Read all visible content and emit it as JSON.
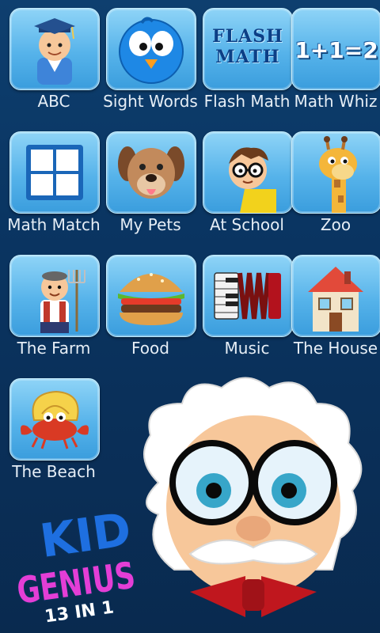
{
  "apps": [
    {
      "label": "ABC",
      "icon": "graduate-boy-icon"
    },
    {
      "label": "Sight Words",
      "icon": "blue-bird-icon"
    },
    {
      "label": "Flash Math",
      "icon": "flash-math-text-icon",
      "icon_text": "FLASH MATH"
    },
    {
      "label": "Math Whiz",
      "icon": "equation-icon",
      "icon_text": "1+1=2"
    },
    {
      "label": "Math Match",
      "icon": "grid-icon"
    },
    {
      "label": "My Pets",
      "icon": "puppy-icon"
    },
    {
      "label": "At School",
      "icon": "school-kid-icon"
    },
    {
      "label": "Zoo",
      "icon": "giraffe-icon"
    },
    {
      "label": "The Farm",
      "icon": "farmer-icon"
    },
    {
      "label": "Food",
      "icon": "burger-icon"
    },
    {
      "label": "Music",
      "icon": "accordion-icon"
    },
    {
      "label": "The House",
      "icon": "house-icon"
    },
    {
      "label": "The Beach",
      "icon": "hermit-crab-icon"
    }
  ],
  "brand": {
    "line1": "KID",
    "line2": "GENIUS",
    "line3": "13 IN 1"
  },
  "colors": {
    "background": "#0a3562",
    "tile": "#56b3ea",
    "label": "#e6eef6",
    "brand_blue": "#1e6fe0",
    "brand_magenta": "#e43ed6"
  }
}
